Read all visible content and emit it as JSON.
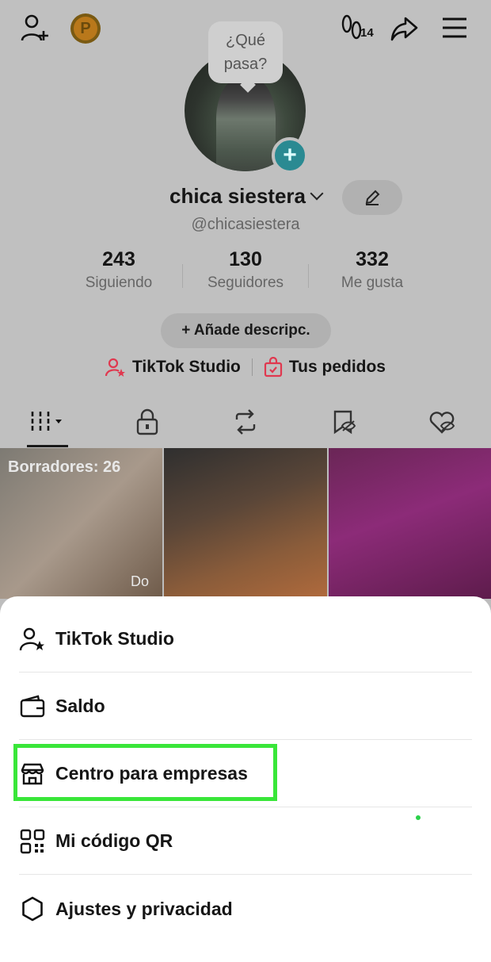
{
  "header": {
    "coin_letter": "P",
    "notif_count": "14"
  },
  "profile": {
    "bubble_text": "¿Qué pasa?",
    "name": "chica siestera",
    "handle": "@chicasiestera",
    "stats": [
      {
        "value": "243",
        "label": "Siguiendo"
      },
      {
        "value": "130",
        "label": "Seguidores"
      },
      {
        "value": "332",
        "label": "Me gusta"
      }
    ],
    "add_desc": "+ Añade descripc.",
    "studio_link": "TikTok Studio",
    "orders_link": "Tus pedidos"
  },
  "grid": {
    "drafts_label": "Borradores: 26",
    "draft_partial": "Do"
  },
  "menu": {
    "items": [
      {
        "label": "TikTok Studio",
        "icon": "person-star-icon"
      },
      {
        "label": "Saldo",
        "icon": "wallet-icon"
      },
      {
        "label": "Centro para empresas",
        "icon": "storefront-icon"
      },
      {
        "label": "Mi código QR",
        "icon": "qr-code-icon"
      },
      {
        "label": "Ajustes y privacidad",
        "icon": "gear-icon"
      }
    ]
  },
  "colors": {
    "highlight": "#39e639",
    "studio_icon": "#e0384f"
  }
}
